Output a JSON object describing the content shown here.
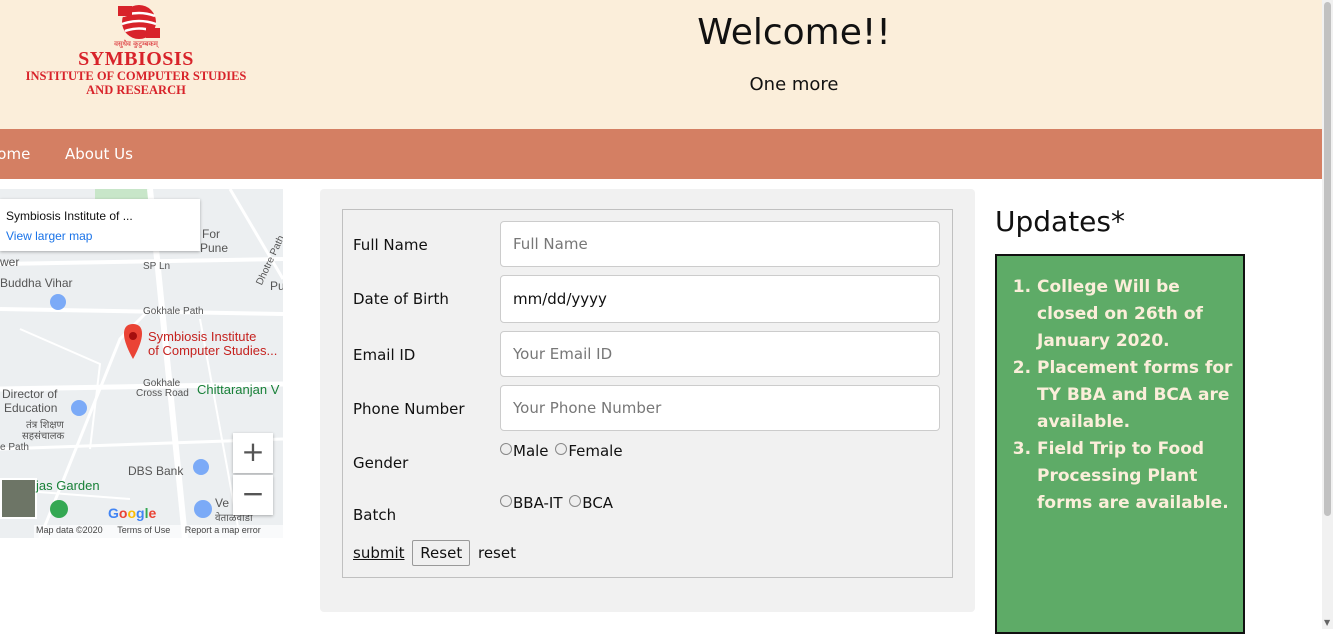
{
  "header": {
    "logo": {
      "tagline": "वसुधैव कुटुम्बकम्",
      "brand": "SYMBIOSIS",
      "line1": "INSTITUTE OF COMPUTER STUDIES",
      "line2": "AND RESEARCH",
      "color": "#d8232a"
    },
    "title": "Welcome!!",
    "subtitle": "One more"
  },
  "nav": {
    "items": [
      {
        "label": "Home"
      },
      {
        "label": "About Us"
      }
    ],
    "background": "#d47f63"
  },
  "map": {
    "place_title": "Symbiosis Institute of ...",
    "view_larger": "View larger map",
    "labels": {
      "for_pune_1": "For",
      "for_pune_2": "Pune",
      "wer": "wer",
      "sp_ln": "SP Ln",
      "buddha_vihar": "Buddha Vihar",
      "gokhale_path": "Gokhale Path",
      "dhotre_path": "Dhotre Path",
      "pu": "Pu",
      "pin_1": "Symbiosis Institute",
      "pin_2": "of Computer Studies...",
      "gokhale_cross_1": "Gokhale",
      "gokhale_cross_2": "Cross Road",
      "chittaranjan": "Chittaranjan V",
      "director_1": "Director of",
      "director_2": "Education",
      "hindi_1": "तंत्र शिक्षण",
      "hindi_2": "सहसंचालक",
      "e_path": "e Path",
      "dbs_bank": "DBS Bank",
      "jas_garden": "jas Garden",
      "ve": "Ve",
      "hindi_3": "वेताळवाडी"
    },
    "zoom_in": "+",
    "zoom_out": "−",
    "google": "Google",
    "footer": {
      "data": "Map data ©2020",
      "terms": "Terms of Use",
      "report": "Report a map error"
    }
  },
  "form": {
    "fields": [
      {
        "label": "Full Name",
        "placeholder": "Full Name"
      },
      {
        "label": "Date of Birth",
        "value": "mm/dd/yyyy"
      },
      {
        "label": "Email ID",
        "placeholder": "Your Email ID"
      },
      {
        "label": "Phone Number",
        "placeholder": "Your Phone Number"
      }
    ],
    "gender": {
      "label": "Gender",
      "options": [
        "Male",
        "Female"
      ]
    },
    "batch": {
      "label": "Batch",
      "options": [
        "BBA-IT",
        "BCA"
      ]
    },
    "actions": {
      "submit": "submit",
      "reset_button": "Reset",
      "reset_text": "reset"
    }
  },
  "updates": {
    "title": "Updates*",
    "items": [
      "College Will be closed on 26th of January 2020.",
      "Placement forms for TY BBA and BCA are available.",
      "Field Trip to Food Processing Plant forms are available."
    ],
    "background": "#5eab67"
  }
}
